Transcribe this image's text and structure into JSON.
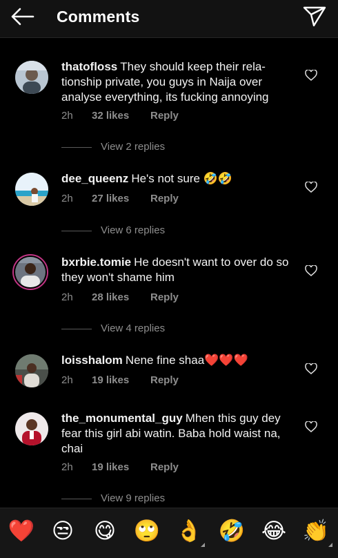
{
  "header": {
    "title": "Comments",
    "back_icon": "arrow-left-icon",
    "send_icon": "paper-plane-icon"
  },
  "comments": [
    {
      "user": "thatofloss",
      "text": "They should keep their rela- tionship private, you guys in Naija over analyse everything, its fucking annoying",
      "time": "2h",
      "likes": "32 likes",
      "reply": "Reply",
      "replies": "View 2 replies"
    },
    {
      "user": "dee_queenz",
      "text": "He's not sure 🤣🤣",
      "time": "2h",
      "likes": "27 likes",
      "reply": "Reply",
      "replies": "View 6 replies"
    },
    {
      "user": "bxrbie.tomie",
      "text": "He doesn't want to over do so they won't shame him",
      "time": "2h",
      "likes": "28 likes",
      "reply": "Reply",
      "replies": "View 4 replies"
    },
    {
      "user": "loisshalom",
      "text": "Nene fine shaa❤️❤️❤️",
      "time": "2h",
      "likes": "19 likes",
      "reply": "Reply"
    },
    {
      "user": "the_monumental_guy",
      "text": "Mhen this guy dey fear this girl abi watin. Baba hold waist na, chai",
      "time": "2h",
      "likes": "19 likes",
      "reply": "Reply",
      "replies": "View 9 replies"
    }
  ],
  "emoji_bar": [
    "❤️",
    "😒",
    "😋",
    "🙄",
    "👌",
    "🤣",
    "😂",
    "👏"
  ]
}
